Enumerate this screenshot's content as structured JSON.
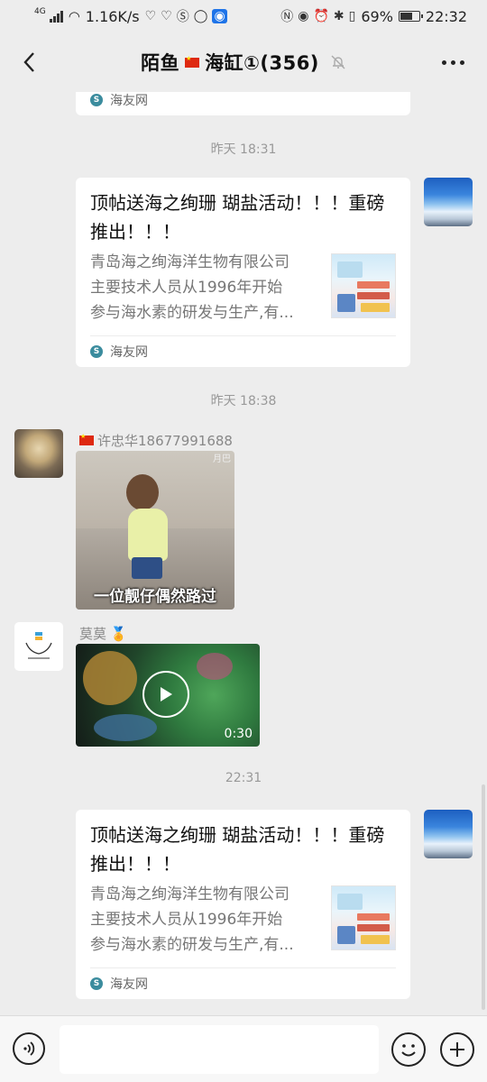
{
  "status_bar": {
    "network_tag": "4G",
    "speed": "1.16K/s",
    "battery": "69%",
    "battery_level": 0.69,
    "time": "22:32"
  },
  "header": {
    "title_part1": "陌鱼",
    "title_part2": "海缸①(356)"
  },
  "messages": [
    {
      "type": "link-card-partial",
      "source": "海友网"
    },
    {
      "type": "timestamp",
      "text": "昨天 18:31"
    },
    {
      "type": "link-card",
      "title": "顶帖送海之绚珊 瑚盐活动！！！重磅推出！！！",
      "desc_lines": [
        "青岛海之绚海洋生物有限公司",
        "主要技术人员从1996年开始",
        "参与海水素的研发与生产,有..."
      ],
      "source": "海友网"
    },
    {
      "type": "timestamp",
      "text": "昨天 18:38"
    },
    {
      "type": "image",
      "sender": "许忠华18677991688",
      "caption": "一位靓仔偶然路过",
      "corner_text": "月巴"
    },
    {
      "type": "video",
      "sender": "莫莫",
      "duration": "0:30"
    },
    {
      "type": "timestamp",
      "text": "22:31"
    },
    {
      "type": "link-card",
      "title": "顶帖送海之绚珊 瑚盐活动！！！重磅推出！！！",
      "desc_lines": [
        "青岛海之绚海洋生物有限公司",
        "主要技术人员从1996年开始",
        "参与海水素的研发与生产,有..."
      ],
      "source": "海友网"
    }
  ],
  "colors": {
    "background": "#ededed",
    "card": "#ffffff",
    "timestamp": "#999999"
  }
}
